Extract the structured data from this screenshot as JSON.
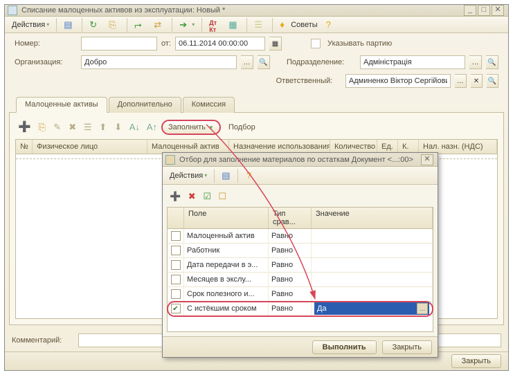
{
  "window": {
    "title": "Списание малоценных активов из эксплуатации: Новый *"
  },
  "toolbar": {
    "actions": "Действия",
    "tips": "Советы"
  },
  "header": {
    "number_label": "Номер:",
    "from_label": "от:",
    "date_value": "06.11.2014 00:00:00",
    "show_batch_label": "Указывать партию",
    "org_label": "Организация:",
    "org_value": "Добро",
    "dept_label": "Подразделение:",
    "dept_value": "Адміністрація",
    "resp_label": "Ответственный:",
    "resp_value": "Админенко Віктор Сергійович"
  },
  "tabs": {
    "t1": "Малоценные активы",
    "t2": "Дополнительно",
    "t3": "Комиссия"
  },
  "subtoolbar": {
    "fill": "Заполнить",
    "select": "Подбор"
  },
  "grid_cols": {
    "c1": "№",
    "c2": "Физическое лицо",
    "c3": "Малоценный актив",
    "c4": "Назначение использования",
    "c5": "Количество",
    "c6": "Ед.",
    "c7": "К.",
    "c8": "Нал. назн. (НДС)"
  },
  "comment": {
    "label": "Комментарий:"
  },
  "footer": {
    "close": "Закрыть"
  },
  "dialog": {
    "title": "Отбор для заполнение материалов по остаткам Документ <...:00>",
    "actions": "Действия",
    "cols": {
      "field": "Поле",
      "cmp": "Тип срав...",
      "val": "Значение"
    },
    "rows": [
      {
        "checked": false,
        "field": "Малоценный актив",
        "cmp": "Равно",
        "val": ""
      },
      {
        "checked": false,
        "field": "Работник",
        "cmp": "Равно",
        "val": ""
      },
      {
        "checked": false,
        "field": "Дата передачи в э...",
        "cmp": "Равно",
        "val": ""
      },
      {
        "checked": false,
        "field": "Месяцев в экслу...",
        "cmp": "Равно",
        "val": ""
      },
      {
        "checked": false,
        "field": "Срок полезного и...",
        "cmp": "Равно",
        "val": ""
      },
      {
        "checked": true,
        "field": "С истёкшим сроком",
        "cmp": "Равно",
        "val": "Да"
      }
    ],
    "run": "Выполнить",
    "close": "Закрыть"
  }
}
